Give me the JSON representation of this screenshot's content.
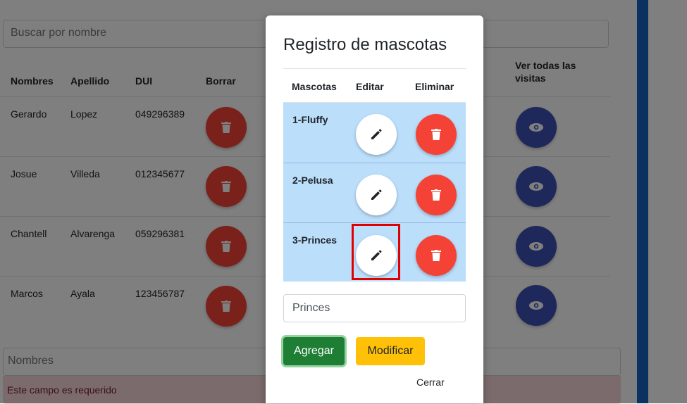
{
  "search": {
    "placeholder": "Buscar por nombre"
  },
  "table": {
    "headers": {
      "nombres": "Nombres",
      "apellido": "Apellido",
      "dui": "DUI",
      "borrar": "Borrar",
      "ver_visitas": "Ver todas las visitas"
    },
    "rows": [
      {
        "nombre": "Gerardo",
        "apellido": "Lopez",
        "dui": "049296389"
      },
      {
        "nombre": "Josue",
        "apellido": "Villeda",
        "dui": "012345677"
      },
      {
        "nombre": "Chantell",
        "apellido": "Alvarenga",
        "dui": "059296381"
      },
      {
        "nombre": "Marcos",
        "apellido": "Ayala",
        "dui": "123456787"
      }
    ]
  },
  "form": {
    "nombres_placeholder": "Nombres",
    "error": "Este campo es requerido"
  },
  "modal": {
    "title": "Registro de mascotas",
    "headers": {
      "mascotas": "Mascotas",
      "editar": "Editar",
      "eliminar": "Eliminar"
    },
    "pets": [
      {
        "label": "1-Fluffy"
      },
      {
        "label": "2-Pelusa"
      },
      {
        "label": "3-Princes"
      }
    ],
    "input_value": "Princes",
    "add_label": "Agregar",
    "modify_label": "Modificar",
    "close_label": "Cerrar"
  },
  "colors": {
    "delete": "#f44336",
    "view": "#3f51b5",
    "row_highlight": "#bbdefb",
    "add": "#1e7e34",
    "modify": "#ffc107",
    "sidebar": "#1565c0",
    "focus_box": "#e00000"
  },
  "icons": {
    "edit": "pencil-icon",
    "delete": "trash-icon",
    "view": "eye-icon"
  }
}
